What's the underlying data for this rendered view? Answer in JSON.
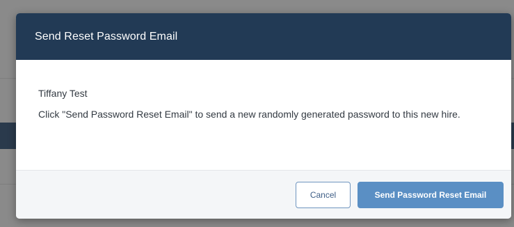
{
  "modal": {
    "title": "Send Reset Password Email",
    "employee_name": "Tiffany Test",
    "instruction": "Click \"Send Password Reset Email\" to send a new randomly generated password to this new hire.",
    "buttons": {
      "cancel_label": "Cancel",
      "confirm_label": "Send Password Reset Email"
    }
  },
  "colors": {
    "header_bg": "#223a55",
    "primary_button": "#5a8fc4",
    "footer_bg": "#f4f6f8",
    "overlay": "#8a8a8a"
  }
}
